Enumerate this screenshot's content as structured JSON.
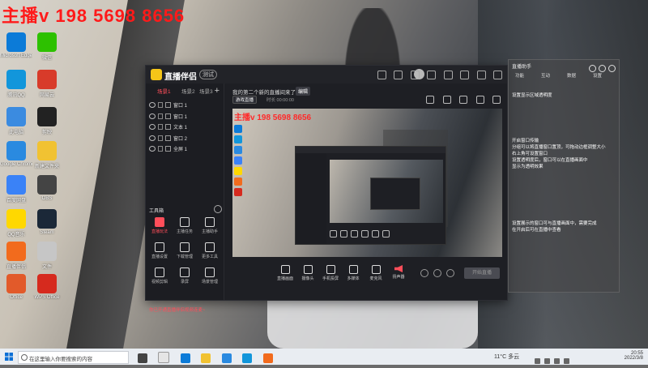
{
  "watermark": "主播v 198 5698 8656",
  "desktop_icons": [
    {
      "label": "Microsoft Edge",
      "color": "#0c7bd8"
    },
    {
      "label": "微信",
      "color": "#2dc100"
    },
    {
      "label": "腾讯QQ",
      "color": "#1296db"
    },
    {
      "label": "网易云",
      "color": "#d83b2a"
    },
    {
      "label": "此电脑",
      "color": "#3b8be0"
    },
    {
      "label": "剪映",
      "color": "#222222"
    },
    {
      "label": "Google Chrome",
      "color": "#2a8ae0"
    },
    {
      "label": "新建文件夹",
      "color": "#f1c232"
    },
    {
      "label": "百度网盘",
      "color": "#3a82f7"
    },
    {
      "label": "OBS",
      "color": "#444444"
    },
    {
      "label": "QQ音乐",
      "color": "#ffd800"
    },
    {
      "label": "Steam",
      "color": "#1b2838"
    },
    {
      "label": "直播伴侣",
      "color": "#f26b1d"
    },
    {
      "label": "文件",
      "color": "#c6c6c6"
    },
    {
      "label": "Office",
      "color": "#e25a2a"
    },
    {
      "label": "WPS Office",
      "color": "#d62a1e"
    }
  ],
  "app": {
    "name": "直播伴侣",
    "badge": "测试",
    "tabs": [
      "场景1",
      "场景2",
      "场景3"
    ],
    "add_label": "+",
    "scenes": [
      "窗口 1",
      "窗口 1",
      "文本 1",
      "窗口 2",
      "全屏 1"
    ],
    "tools_title": "工具箱",
    "tools": [
      {
        "label": "直播玩法",
        "active": true
      },
      {
        "label": "主播任务",
        "active": false
      },
      {
        "label": "主播助手",
        "active": false
      },
      {
        "label": "直播设置",
        "active": false
      },
      {
        "label": "下载管理",
        "active": false
      },
      {
        "label": "更多工具",
        "active": false
      },
      {
        "label": "视频剪辑",
        "active": false
      },
      {
        "label": "录屏",
        "active": false
      },
      {
        "label": "场景管理",
        "active": false
      }
    ],
    "notice": "你已开通直播伴侣视频连麦~",
    "room_title": "我的第二个新的直播间来了",
    "room_edit": "编辑",
    "room_category": "游戏直播",
    "room_meta": "时长 00:00:00",
    "controls": [
      "直播画面",
      "摄像头",
      "手机投屏",
      "多媒体",
      "麦克风",
      "扬声器"
    ],
    "live_button": "开始直播"
  },
  "right_panel": {
    "title": "直播助手",
    "tabs": [
      "功能",
      "互动",
      "数据",
      "设置"
    ],
    "lines": [
      "设置显示区域透明度",
      "开启窗口传输",
      "分组可以将直播窗口置顶，可拖动边框调整大小",
      "右上角可设置窗口",
      "设置透明度后，窗口可以在直播画面中",
      "显示为透明效果",
      "设置展示的窗口可与直播画面中，需要完成",
      "在开启后可在直播中查看"
    ]
  },
  "taskbar": {
    "search_placeholder": "在这里输入你要搜索的内容",
    "weather": "11°C 多云",
    "time": "20:55",
    "date": "2022/3/8",
    "task_icon_colors": [
      "#444444",
      "#e5e5e5",
      "#0c7bd8",
      "#f1c232",
      "#2a8ae0",
      "#1296db",
      "#f26b1d"
    ]
  }
}
